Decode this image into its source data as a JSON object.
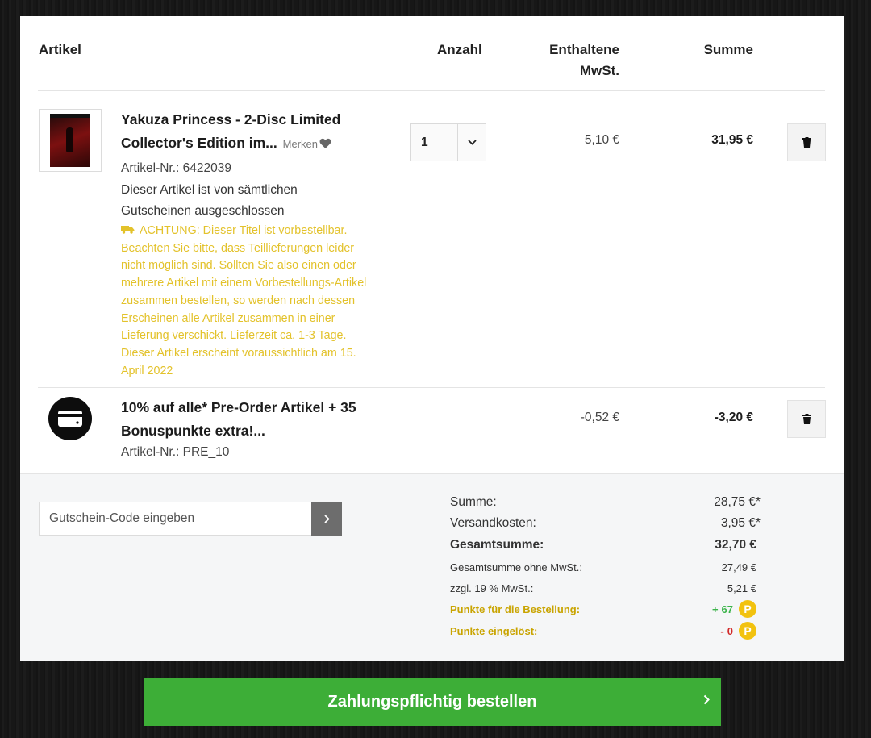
{
  "header": {
    "artikel": "Artikel",
    "anzahl": "Anzahl",
    "mwst_line1": "Enthaltene",
    "mwst_line2": "MwSt.",
    "summe": "Summe"
  },
  "items": [
    {
      "title": "Yakuza Princess - 2-Disc Limited Collector's Edition im...",
      "merken": "Merken",
      "article_no": "Artikel-Nr.: 6422039",
      "note": "Dieser Artikel ist von sämtlichen Gutscheinen ausgeschlossen",
      "warning": "ACHTUNG: Dieser Titel ist vorbestellbar. Beachten Sie bitte, dass Teillieferungen leider nicht möglich sind. Sollten Sie also einen oder mehrere Artikel mit einem Vorbestellungs-Artikel zusammen bestellen, so werden nach dessen Erscheinen alle Artikel zusammen in einer Lieferung verschickt. Lieferzeit ca. 1-3 Tage. Dieser Artikel erscheint voraussichtlich am 15. April 2022",
      "quantity": "1",
      "mwst": "5,10 €",
      "sum": "31,95 €",
      "icon": "movie-cover-thumbnail"
    },
    {
      "title": "10% auf alle* Pre-Order Artikel + 35 Bonuspunkte extra!...",
      "article_no": "Artikel-Nr.: PRE_10",
      "mwst": "-0,52 €",
      "sum": "-3,20 €",
      "icon": "voucher-icon"
    }
  ],
  "coupon": {
    "placeholder": "Gutschein-Code eingeben"
  },
  "totals": {
    "summe_label": "Summe:",
    "summe_value": "28,75 €*",
    "versand_label": "Versandkosten:",
    "versand_value": "3,95 €*",
    "gesamt_label": "Gesamtsumme:",
    "gesamt_value": "32,70 €",
    "ohne_mwst_label": "Gesamtsumme ohne MwSt.:",
    "ohne_mwst_value": "27,49 €",
    "mwst_label": "zzgl. 19 % MwSt.:",
    "mwst_value": "5,21 €",
    "punkte_label": "Punkte für die Bestellung:",
    "punkte_sign": "+",
    "punkte_value": "67",
    "eingeloest_label": "Punkte eingelöst:",
    "eingeloest_sign": "-",
    "eingeloest_value": "0",
    "points_badge": "P"
  },
  "order_button": {
    "label": "Zahlungspflichtig bestellen"
  },
  "colors": {
    "accent_green": "#3dae37",
    "warning_yellow": "#e3c22b",
    "points_gold": "#f2c20f"
  }
}
